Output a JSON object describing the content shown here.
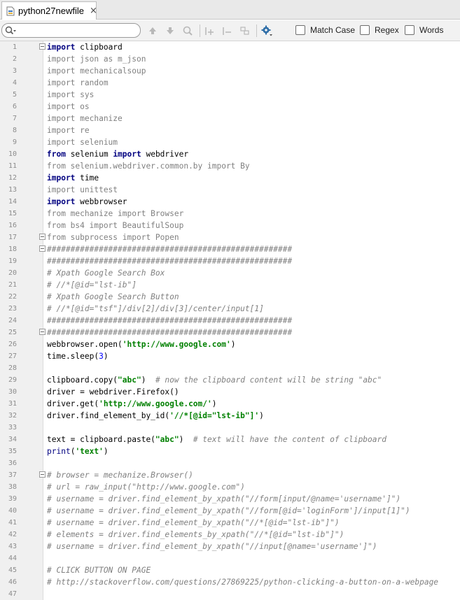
{
  "tab": {
    "label": "python27newfile",
    "close": "×"
  },
  "search": {
    "value": "",
    "options": [
      {
        "label": "Match Case",
        "checked": false
      },
      {
        "label": "Regex",
        "checked": false
      },
      {
        "label": "Words",
        "checked": false
      }
    ]
  },
  "editor": {
    "lines": [
      {
        "n": "1",
        "fold": true,
        "seg": [
          [
            "kw",
            "import"
          ],
          [
            "t",
            " clipboard"
          ]
        ]
      },
      {
        "n": "2",
        "fold": false,
        "seg": [
          [
            "u",
            "import json as m_json"
          ]
        ]
      },
      {
        "n": "3",
        "fold": false,
        "seg": [
          [
            "u",
            "import mechanicalsoup"
          ]
        ]
      },
      {
        "n": "4",
        "fold": false,
        "seg": [
          [
            "u",
            "import random"
          ]
        ]
      },
      {
        "n": "5",
        "fold": false,
        "seg": [
          [
            "u",
            "import sys"
          ]
        ]
      },
      {
        "n": "6",
        "fold": false,
        "seg": [
          [
            "u",
            "import os"
          ]
        ]
      },
      {
        "n": "7",
        "fold": false,
        "seg": [
          [
            "u",
            "import mechanize"
          ]
        ]
      },
      {
        "n": "8",
        "fold": false,
        "seg": [
          [
            "u",
            "import re"
          ]
        ]
      },
      {
        "n": "9",
        "fold": false,
        "seg": [
          [
            "u",
            "import selenium"
          ]
        ]
      },
      {
        "n": "10",
        "fold": false,
        "seg": [
          [
            "kw",
            "from"
          ],
          [
            "t",
            " selenium "
          ],
          [
            "kw",
            "import"
          ],
          [
            "t",
            " webdriver"
          ]
        ]
      },
      {
        "n": "11",
        "fold": false,
        "seg": [
          [
            "u",
            "from selenium.webdriver.common.by import By"
          ]
        ]
      },
      {
        "n": "12",
        "fold": false,
        "seg": [
          [
            "kw",
            "import"
          ],
          [
            "t",
            " time"
          ]
        ]
      },
      {
        "n": "13",
        "fold": false,
        "seg": [
          [
            "u",
            "import unittest"
          ]
        ]
      },
      {
        "n": "14",
        "fold": false,
        "seg": [
          [
            "kw",
            "import"
          ],
          [
            "t",
            " webbrowser"
          ]
        ]
      },
      {
        "n": "15",
        "fold": false,
        "seg": [
          [
            "u",
            "from mechanize import Browser"
          ]
        ]
      },
      {
        "n": "16",
        "fold": false,
        "seg": [
          [
            "u",
            "from bs4 import BeautifulSoup"
          ]
        ]
      },
      {
        "n": "17",
        "fold": true,
        "seg": [
          [
            "u",
            "from subprocess import Popen"
          ]
        ]
      },
      {
        "n": "18",
        "fold": true,
        "seg": [
          [
            "c",
            "####################################################"
          ]
        ]
      },
      {
        "n": "19",
        "fold": false,
        "seg": [
          [
            "c",
            "####################################################"
          ]
        ]
      },
      {
        "n": "20",
        "fold": false,
        "seg": [
          [
            "c",
            "# Xpath Google Search Box"
          ]
        ]
      },
      {
        "n": "21",
        "fold": false,
        "seg": [
          [
            "c",
            "# //*[@id=\"lst-ib\"]"
          ]
        ]
      },
      {
        "n": "22",
        "fold": false,
        "seg": [
          [
            "c",
            "# Xpath Google Search Button"
          ]
        ]
      },
      {
        "n": "23",
        "fold": false,
        "seg": [
          [
            "c",
            "# //*[@id=\"tsf\"]/div[2]/div[3]/center/input[1]"
          ]
        ]
      },
      {
        "n": "24",
        "fold": false,
        "seg": [
          [
            "c",
            "####################################################"
          ]
        ]
      },
      {
        "n": "25",
        "fold": true,
        "seg": [
          [
            "c",
            "####################################################"
          ]
        ]
      },
      {
        "n": "26",
        "fold": false,
        "seg": [
          [
            "t",
            "webbrowser.open("
          ],
          [
            "s",
            "'http://www.google.com'"
          ],
          [
            "t",
            ")"
          ]
        ]
      },
      {
        "n": "27",
        "fold": false,
        "seg": [
          [
            "t",
            "time.sleep("
          ],
          [
            "n",
            "3"
          ],
          [
            "t",
            ")"
          ]
        ]
      },
      {
        "n": "28",
        "fold": false,
        "seg": []
      },
      {
        "n": "29",
        "fold": false,
        "seg": [
          [
            "t",
            "clipboard.copy("
          ],
          [
            "s",
            "\"abc\""
          ],
          [
            "t",
            ")  "
          ],
          [
            "c",
            "# now the clipboard content will be string \"abc\""
          ]
        ]
      },
      {
        "n": "30",
        "fold": false,
        "seg": [
          [
            "t",
            "driver = webdriver.Firefox()"
          ]
        ]
      },
      {
        "n": "31",
        "fold": false,
        "seg": [
          [
            "t",
            "driver.get("
          ],
          [
            "s",
            "'http://www.google.com/'"
          ],
          [
            "t",
            ")"
          ]
        ]
      },
      {
        "n": "32",
        "fold": false,
        "seg": [
          [
            "t",
            "driver.find_element_by_id("
          ],
          [
            "s",
            "'//*[@id=\"lst-ib\"]'"
          ],
          [
            "t",
            ")"
          ]
        ]
      },
      {
        "n": "33",
        "fold": false,
        "seg": []
      },
      {
        "n": "34",
        "fold": false,
        "seg": [
          [
            "t",
            "text = clipboard.paste("
          ],
          [
            "s",
            "\"abc\""
          ],
          [
            "t",
            ")  "
          ],
          [
            "c",
            "# text will have the content of clipboard"
          ]
        ]
      },
      {
        "n": "35",
        "fold": false,
        "seg": [
          [
            "b",
            "print"
          ],
          [
            "t",
            "("
          ],
          [
            "s",
            "'text'"
          ],
          [
            "t",
            ")"
          ]
        ]
      },
      {
        "n": "36",
        "fold": false,
        "seg": []
      },
      {
        "n": "37",
        "fold": true,
        "seg": [
          [
            "c",
            "# browser = mechanize.Browser()"
          ]
        ]
      },
      {
        "n": "38",
        "fold": false,
        "seg": [
          [
            "c",
            "# url = raw_input(\"http://www.google.com\")"
          ]
        ]
      },
      {
        "n": "39",
        "fold": false,
        "seg": [
          [
            "c",
            "# username = driver.find_element_by_xpath(\"//form[input/@name='username']\")"
          ]
        ]
      },
      {
        "n": "40",
        "fold": false,
        "seg": [
          [
            "c",
            "# username = driver.find_element_by_xpath(\"//form[@id='loginForm']/input[1]\")"
          ]
        ]
      },
      {
        "n": "41",
        "fold": false,
        "seg": [
          [
            "c",
            "# username = driver.find_element_by_xpath(\"//*[@id=\"lst-ib\"]\")"
          ]
        ]
      },
      {
        "n": "42",
        "fold": false,
        "seg": [
          [
            "c",
            "# elements = driver.find_elements_by_xpath(\"//*[@id=\"lst-ib\"]\")"
          ]
        ]
      },
      {
        "n": "43",
        "fold": false,
        "seg": [
          [
            "c",
            "# username = driver.find_element_by_xpath(\"//input[@name='username']\")"
          ]
        ]
      },
      {
        "n": "44",
        "fold": false,
        "seg": []
      },
      {
        "n": "45",
        "fold": false,
        "seg": [
          [
            "c",
            "# CLICK BUTTON ON PAGE"
          ]
        ]
      },
      {
        "n": "46",
        "fold": false,
        "seg": [
          [
            "c",
            "# http://stackoverflow.com/questions/27869225/python-clicking-a-button-on-a-webpage"
          ]
        ]
      },
      {
        "n": "47",
        "fold": false,
        "seg": []
      }
    ]
  }
}
